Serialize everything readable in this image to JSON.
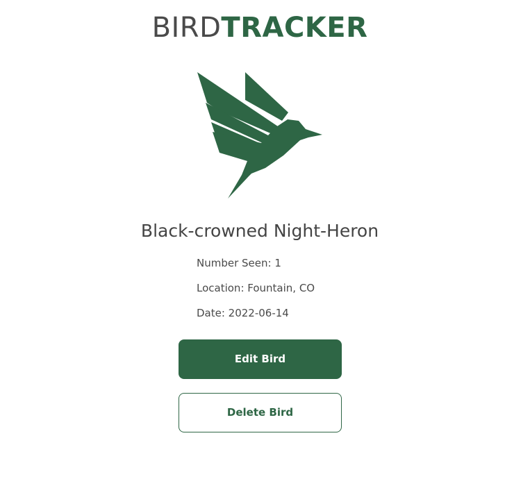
{
  "header": {
    "brand_part1": "BIRD",
    "brand_part2": "TRACKER"
  },
  "logo": {
    "icon": "bird-icon",
    "color": "#2e6645"
  },
  "bird": {
    "name": "Black-crowned Night-Heron",
    "number_seen": "Number Seen: 1",
    "location": "Location: Fountain, CO",
    "date": "Date: 2022-06-14"
  },
  "actions": {
    "edit_label": "Edit Bird",
    "delete_label": "Delete Bird"
  },
  "colors": {
    "accent": "#2e6645",
    "text": "#444444"
  }
}
